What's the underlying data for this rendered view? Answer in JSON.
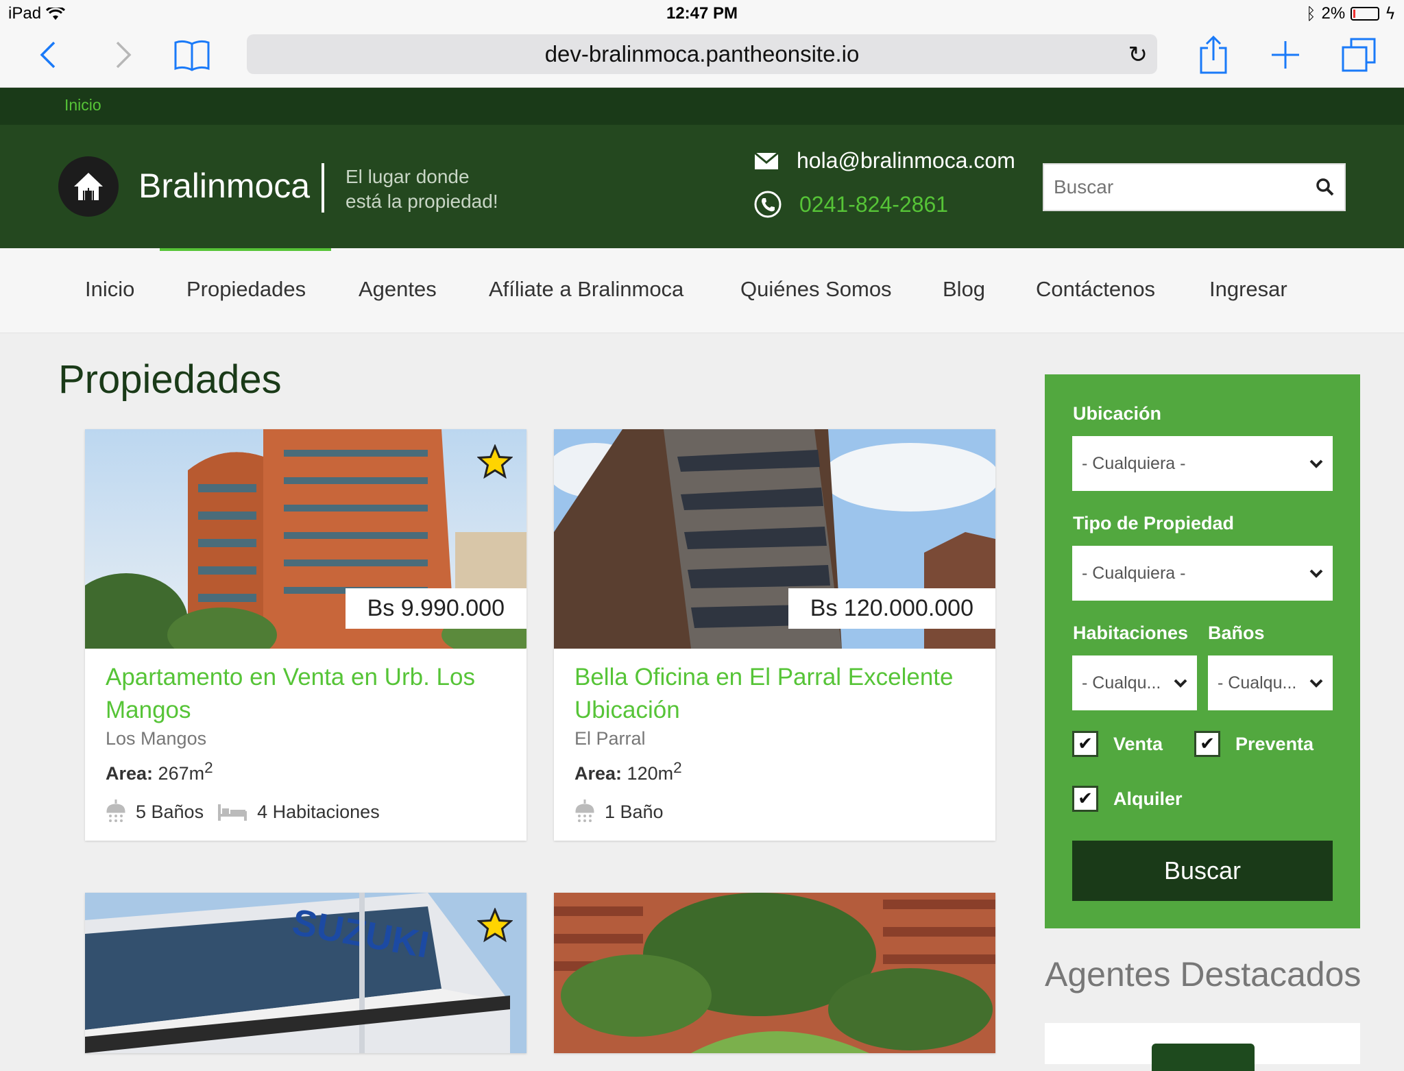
{
  "status_bar": {
    "device": "iPad",
    "time": "12:47 PM",
    "battery": "2%"
  },
  "browser": {
    "url": "dev-bralinmoca.pantheonsite.io"
  },
  "breadcrumb": {
    "home": "Inicio"
  },
  "header": {
    "brand": "Bralinmoca",
    "tagline_line1": "El lugar donde",
    "tagline_line2": "está la propiedad!",
    "email": "hola@bralinmoca.com",
    "phone": "0241-824-2861",
    "search_placeholder": "Buscar"
  },
  "nav": {
    "items": [
      "Inicio",
      "Propiedades",
      "Agentes",
      "Afíliate a Bralinmoca",
      "Quiénes Somos",
      "Blog",
      "Contáctenos",
      "Ingresar"
    ],
    "active": "Propiedades"
  },
  "main": {
    "title": "Propiedades",
    "cards": [
      {
        "price": "Bs 9.990.000",
        "title": "Apartamento en Venta en Urb. Los Mangos",
        "location": "Los Mangos",
        "area_label": "Area:",
        "area_value": "267m",
        "area_sup": "2",
        "baths": "5 Baños",
        "rooms": "4 Habitaciones",
        "featured": true
      },
      {
        "price": "Bs 120.000.000",
        "title": "Bella Oficina en El Parral Excelente Ubicación",
        "location": "El Parral",
        "area_label": "Area:",
        "area_value": "120m",
        "area_sup": "2",
        "baths": "1 Baño",
        "rooms": "",
        "featured": false
      }
    ]
  },
  "sidebar": {
    "ubicacion_label": "Ubicación",
    "ubicacion_value": "- Cualquiera -",
    "tipo_label": "Tipo de Propiedad",
    "tipo_value": "- Cualquiera -",
    "habitaciones_label": "Habitaciones",
    "habitaciones_value": "- Cualqu...",
    "banos_label": "Baños",
    "banos_value": "- Cualqu...",
    "venta": "Venta",
    "preventa": "Preventa",
    "alquiler": "Alquiler",
    "button": "Buscar"
  },
  "agents": {
    "title": "Agentes Destacados"
  },
  "colors": {
    "brand_green": "#56c437",
    "header_dark": "#24481f",
    "sidebar_green": "#52a83f",
    "button_dark": "#1a3a18"
  }
}
